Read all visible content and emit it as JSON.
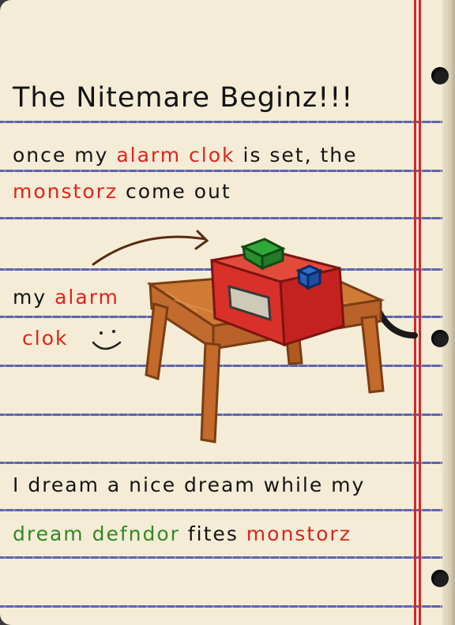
{
  "title": "The Nitemare Beginz!!!",
  "line1": {
    "part1": "once my ",
    "highlight": "alarm clok",
    "part2": " is set, the"
  },
  "line2": {
    "highlight": "monstorz",
    "part2": " come out"
  },
  "label": {
    "line1_plain": "my ",
    "line1_highlight": "alarm",
    "line2_highlight": "clok",
    "smiley": "⌣"
  },
  "line3": "I dream a nice dream while my",
  "line4": {
    "green": "dream defndor",
    "plain": " fites ",
    "red": "monstorz"
  },
  "colors": {
    "paper": "#f4ecd6",
    "rule": "#4b56a8",
    "margin": "#d4262a",
    "accent_red": "#e2231a",
    "accent_green": "#2f8a22",
    "ink": "#141414"
  },
  "icons": [
    "arrow-doodle",
    "alarm-clock-drawing",
    "table-drawing",
    "cord-drawing",
    "smiley-icon",
    "binder-hole-icon"
  ]
}
